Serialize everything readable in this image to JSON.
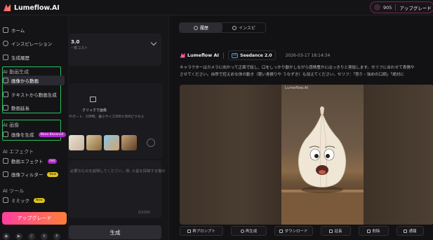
{
  "app": {
    "name": "Lumeflow.AI"
  },
  "topbar": {
    "credits": "905",
    "upgrade_label": "アップグレード"
  },
  "nav": {
    "main": [
      {
        "label": "ホーム",
        "icon": "home-icon"
      },
      {
        "label": "インスピレーション",
        "icon": "compass-icon"
      },
      {
        "label": "生成履歴",
        "icon": "history-icon"
      }
    ],
    "video_section_title": "AI 動画生成",
    "video_items": [
      {
        "label": "画像から動画",
        "icon": "image-to-video-icon",
        "active": true
      },
      {
        "label": "テキストから動画生成",
        "icon": "text-to-video-icon"
      },
      {
        "label": "動画延長",
        "icon": "video-extend-icon"
      }
    ],
    "image_section_title": "AI 画像",
    "image_items": [
      {
        "label": "画像を生成",
        "icon": "image-gen-icon",
        "badge": "Nano Banana2"
      }
    ],
    "effects_section_title": "AI エフェクト",
    "effect_items": [
      {
        "label": "動画エフェクト",
        "icon": "video-effect-icon",
        "badge": "Hot"
      },
      {
        "label": "画像フィルター",
        "icon": "image-filter-icon",
        "badge": "New"
      }
    ],
    "tools_section_title": "AI ツール",
    "tool_items": [
      {
        "label": "ミミック",
        "icon": "mimic-icon",
        "badge": "New"
      }
    ],
    "upgrade_button": "アップグレード",
    "socials": [
      "discord-icon",
      "youtube-icon",
      "tiktok-icon",
      "x-icon",
      "pinterest-icon"
    ]
  },
  "panel": {
    "model_name": "3.0",
    "model_sub": "・低コスト",
    "upload_title": "クリックで画像",
    "upload_hint": "サポート、10MB。最小サイズ300×300ピクセル",
    "prompt_placeholder": "必要なものを説明してください。例: 火星を探検する猫の",
    "char_count": "0/2000",
    "generate_button": "生成"
  },
  "main": {
    "tabs": [
      {
        "label": "履歴",
        "active": true,
        "icon": "clock-icon"
      },
      {
        "label": "インスピ",
        "active": false,
        "icon": "refresh-icon"
      }
    ],
    "result": {
      "brand": "Lumeflow AI",
      "model_badge": "Seedance 2.0",
      "timestamp": "2026-03-17 18:14:34",
      "description_line1": "キャラクターはカメラに向かって正面で話し、口をしっかり動かしながら感情豊かにはっきりと発話します。セリフに合わせて表情や",
      "description_line2": "させてください。自然で控えめな体の動き（軽い身振りや うなずき）も加えてください。セリフ：「怒り・強めの口調」「絶対に",
      "watermark": "Lumeflow.AI"
    },
    "actions": [
      {
        "label": "再プロンプト",
        "icon": "edit-icon"
      },
      {
        "label": "再生成",
        "icon": "regenerate-icon"
      },
      {
        "label": "ダウンロード",
        "icon": "download-icon"
      },
      {
        "label": "延長",
        "icon": "extend-icon"
      },
      {
        "label": "削除",
        "icon": "trash-icon"
      },
      {
        "label": "通報",
        "icon": "report-icon"
      }
    ]
  },
  "colors": {
    "accent_green": "#27c25a",
    "upgrade_gradient_start": "#ff3fa0",
    "upgrade_gradient_end": "#ff7f3a",
    "badge_purple": "#b028c8",
    "badge_yellow": "#e0c61a",
    "model_blue": "#3da0ff"
  }
}
